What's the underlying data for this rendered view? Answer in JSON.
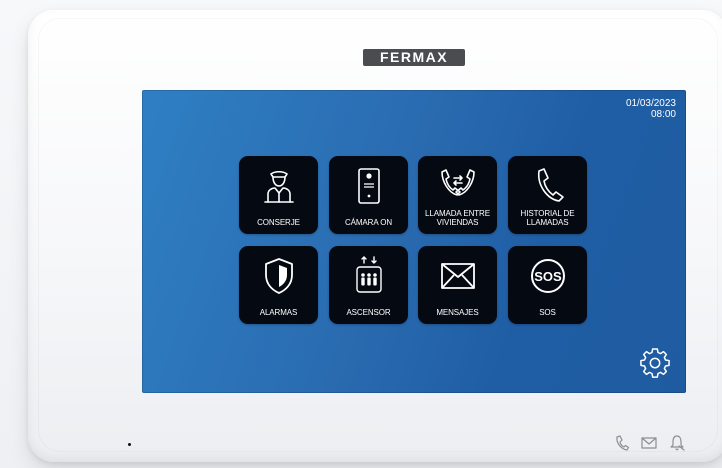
{
  "brand": {
    "name": "FERMAX"
  },
  "screen": {
    "date": "01/03/2023",
    "time": "08:00",
    "background_color": "#2a6bb0"
  },
  "menu": {
    "tiles": [
      {
        "label": "CONSERJE",
        "icon": "concierge-icon"
      },
      {
        "label": "CÁMARA ON",
        "icon": "camera-panel-icon"
      },
      {
        "label": "LLAMADA ENTRE\nVIVIENDAS",
        "icon": "intercom-call-icon"
      },
      {
        "label": "HISTORIAL DE\nLLAMADAS",
        "icon": "call-history-icon"
      },
      {
        "label": "ALARMAS",
        "icon": "shield-icon"
      },
      {
        "label": "ASCENSOR",
        "icon": "elevator-icon"
      },
      {
        "label": "MENSAJES",
        "icon": "envelope-icon"
      },
      {
        "label": "SOS",
        "icon": "sos-icon"
      }
    ]
  },
  "settings": {
    "icon": "gear-icon"
  },
  "front_panel": {
    "icons": [
      "phone-icon",
      "mail-icon",
      "bell-muted-icon"
    ]
  },
  "colors": {
    "tile": "#050a12",
    "bezel": "#ffffff",
    "brand_label": "#4a4c50"
  }
}
